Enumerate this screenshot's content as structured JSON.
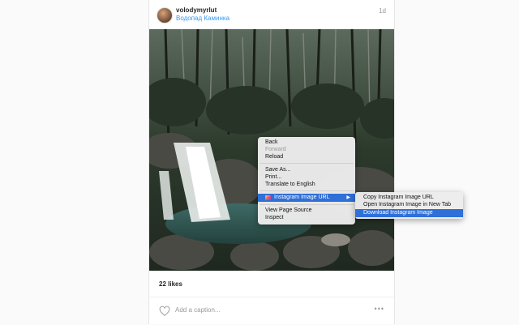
{
  "post": {
    "username": "volodymyrlut",
    "location": "Водопад Каминка",
    "time": "1d",
    "likes": "22 likes",
    "caption_placeholder": "Add a caption...",
    "more": "•••"
  },
  "context_menu": {
    "back": "Back",
    "forward": "Forward",
    "reload": "Reload",
    "save_as": "Save As...",
    "print": "Print...",
    "translate": "Translate to English",
    "extension": "Instagram Image URL",
    "view_source": "View Page Source",
    "inspect": "Inspect",
    "arrow": "▶"
  },
  "submenu": {
    "copy": "Copy Instagram Image URL",
    "open": "Open Instagram Image in New Tab",
    "download": "Download Instagram Image"
  },
  "colors": {
    "link": "#3897f0",
    "highlight": "#2f6fd8"
  }
}
